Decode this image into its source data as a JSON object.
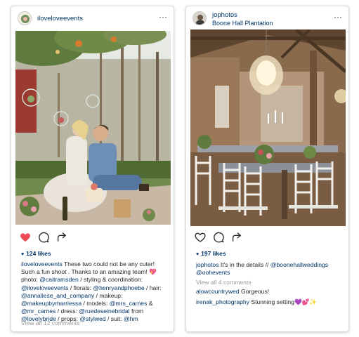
{
  "posts": [
    {
      "username": "iloveloveevents",
      "location": "",
      "liked": true,
      "likes": "124 likes",
      "caption_lines": [
        [
          {
            "t": "u",
            "v": "iloveloveevents"
          },
          {
            "t": "x",
            "v": " These two could not be any cuter!"
          }
        ],
        [
          {
            "t": "x",
            "v": "Such a fun shoot .  Thanks to an amazing team! 💖"
          }
        ],
        [
          {
            "t": "x",
            "v": "photo: "
          },
          {
            "t": "m",
            "v": "@caitramsden"
          },
          {
            "t": "x",
            "v": " / styling & coordination:"
          }
        ],
        [
          {
            "t": "m",
            "v": "@iloveloveevents"
          },
          {
            "t": "x",
            "v": " / florals: "
          },
          {
            "t": "m",
            "v": "@henryandphoebe"
          },
          {
            "t": "x",
            "v": " / hair:"
          }
        ],
        [
          {
            "t": "m",
            "v": "@annaliese_and_company"
          },
          {
            "t": "x",
            "v": " / makeup:"
          }
        ],
        [
          {
            "t": "m",
            "v": "@makeupbymarriessa"
          },
          {
            "t": "x",
            "v": " / models: "
          },
          {
            "t": "m",
            "v": "@mrs_carnes"
          },
          {
            "t": "x",
            "v": " &"
          }
        ],
        [
          {
            "t": "m",
            "v": "@mr_carnes"
          },
          {
            "t": "x",
            "v": " / dress: "
          },
          {
            "t": "m",
            "v": "@ruedeseinebridal"
          },
          {
            "t": "x",
            "v": " from"
          }
        ],
        [
          {
            "t": "m",
            "v": "@lovelybride"
          },
          {
            "t": "x",
            "v": " / props: "
          },
          {
            "t": "m",
            "v": "@stylwed"
          },
          {
            "t": "x",
            "v": " / suit: "
          },
          {
            "t": "m",
            "v": "@hm"
          }
        ]
      ],
      "view_all": "View all 12 comments",
      "icons": [
        "heart-icon",
        "comment-icon",
        "share-icon",
        "more-icon"
      ]
    },
    {
      "username": "jophotos",
      "location": "Boone Hall Plantation",
      "liked": false,
      "likes": "197 likes",
      "caption_lines": [
        [
          {
            "t": "u",
            "v": "jophotos"
          },
          {
            "t": "x",
            "v": " It's in the details // "
          },
          {
            "t": "m",
            "v": "@boonehallweddings"
          }
        ],
        [
          {
            "t": "m",
            "v": "@oohevents"
          }
        ]
      ],
      "view_all": "View all 4 comments",
      "comments": [
        {
          "user": "alowcountrywed",
          "text": " Gorgeous!"
        },
        {
          "user": "irenak_photography",
          "text": " Stunning setting💜💕✨"
        }
      ],
      "icons": [
        "heart-outline-icon",
        "comment-icon",
        "share-icon",
        "more-icon"
      ]
    }
  ],
  "more_glyph": "···",
  "colors": {
    "link": "#003569",
    "liked_heart": "#ed4956",
    "muted": "#999999"
  }
}
